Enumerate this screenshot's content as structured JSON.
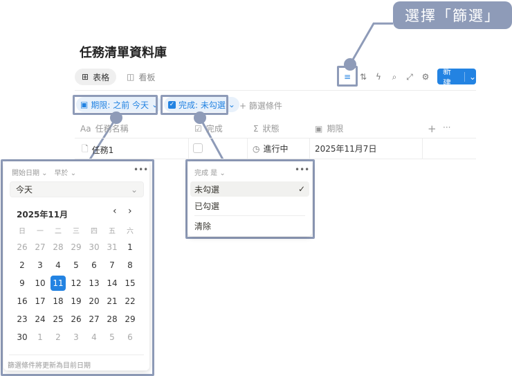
{
  "callout": "選擇「篩選」",
  "title": "任務清單資料庫",
  "tabs": [
    {
      "label": "表格",
      "icon": "table-icon"
    },
    {
      "label": "看板",
      "icon": "board-icon"
    }
  ],
  "toolbar": {
    "new_label": "新建"
  },
  "filters": {
    "date_chip": "期限: 之前 今天",
    "done_chip": "完成: 未勾選",
    "add_filter": "+ 篩選條件"
  },
  "columns": [
    {
      "icon": "Aa",
      "label": "任務名稱"
    },
    {
      "icon": "☑",
      "label": "完成"
    },
    {
      "icon": "Σ",
      "label": "狀態"
    },
    {
      "icon": "calendar",
      "label": "期限"
    }
  ],
  "rows": [
    {
      "name": "任務1",
      "done": false,
      "status": "進行中",
      "due": "2025年11月7日"
    }
  ],
  "date_popup": {
    "property": "開始日期",
    "operator": "早於",
    "value": "今天",
    "month": "2025年11月",
    "weekdays": [
      "日",
      "一",
      "二",
      "三",
      "四",
      "五",
      "六"
    ],
    "weeks": [
      [
        "26",
        "27",
        "28",
        "29",
        "30",
        "31",
        "1"
      ],
      [
        "2",
        "3",
        "4",
        "5",
        "6",
        "7",
        "8"
      ],
      [
        "9",
        "10",
        "11",
        "12",
        "13",
        "14",
        "15"
      ],
      [
        "16",
        "17",
        "18",
        "19",
        "20",
        "21",
        "22"
      ],
      [
        "23",
        "24",
        "25",
        "26",
        "27",
        "28",
        "29"
      ],
      [
        "30",
        "1",
        "2",
        "3",
        "4",
        "5",
        "6"
      ]
    ],
    "selected": "11",
    "footer": "篩選條件將更新為目前日期"
  },
  "done_popup": {
    "header": "完成 是",
    "options": [
      "未勾選",
      "已勾選"
    ],
    "selected": "未勾選",
    "clear": "清除"
  }
}
